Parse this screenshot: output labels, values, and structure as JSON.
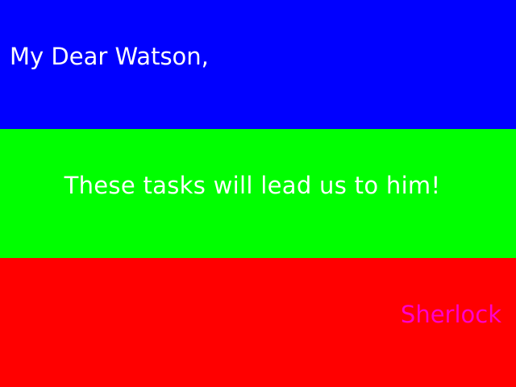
{
  "colors": {
    "top_band": "#0000ff",
    "middle_band": "#00ff00",
    "bottom_band": "#ff0000",
    "greeting_text": "#ffffff",
    "message_text": "#ffffff",
    "signature_text": "#ff00cc"
  },
  "letter": {
    "greeting": "My Dear Watson,",
    "message": "These tasks will lead us to him!",
    "signature": "Sherlock"
  }
}
